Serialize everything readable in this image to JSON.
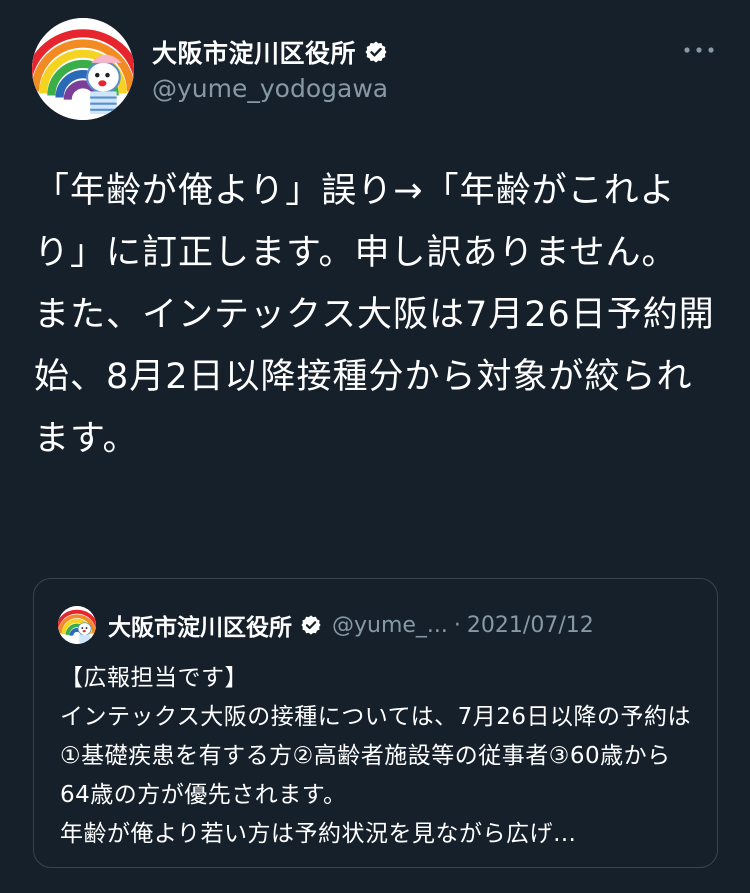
{
  "tweet": {
    "author": {
      "display_name": "大阪市淀川区役所",
      "handle": "@yume_yodogawa",
      "avatar_icon": "rainbow-mascot-avatar",
      "verified_icon": "verified-badge-icon"
    },
    "more_icon": "more-options-icon",
    "text": "「年齢が俺より」誤り→「年齢がこれより」に訂正します。申し訳ありません。\nまた、インテックス大阪は7月26日予約開始、8月2日以降接種分から対象が絞られます。"
  },
  "quoted_tweet": {
    "display_name": "大阪市淀川区役所",
    "handle": "@yume_...",
    "separator": "·",
    "date": "2021/07/12",
    "text": "【広報担当です】\nインテックス大阪の接種については、7月26日以降の予約は①基礎疾患を有する方②高齢者施設等の従事者③60歳から64歳の方が優先されます。\n年齢が俺より若い方は予約状況を見ながら広げ…"
  },
  "colors": {
    "background": "#15202b",
    "text_primary": "#ffffff",
    "text_secondary": "#8899a6",
    "border": "#38444d"
  }
}
